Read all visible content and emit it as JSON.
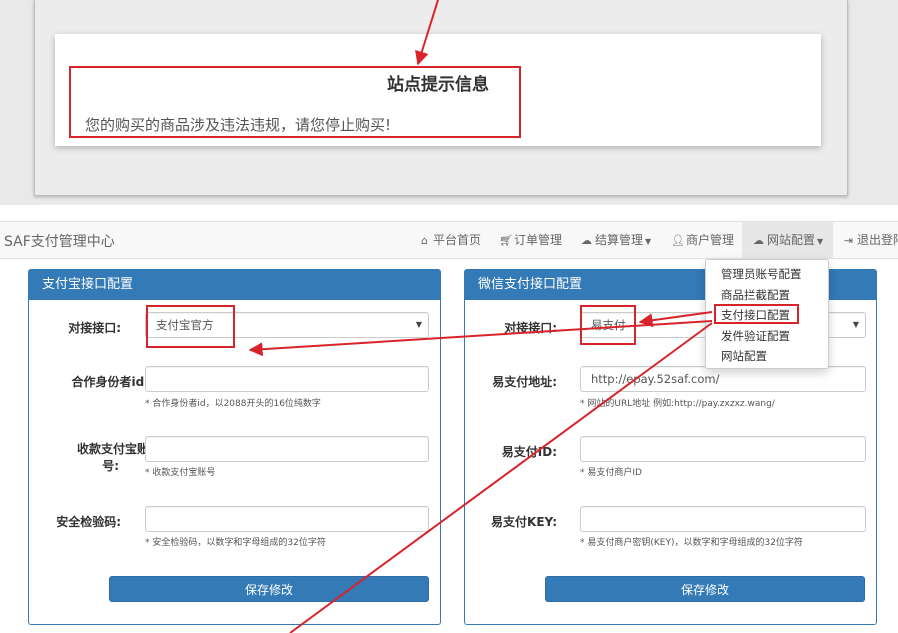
{
  "notice": {
    "title": "站点提示信息",
    "message": "您的购买的商品涉及违法违规，请您停止购买!"
  },
  "navbar": {
    "brand": "SAF支付管理中心",
    "items": [
      {
        "label": "平台首页",
        "icon": "home-icon"
      },
      {
        "label": "订单管理",
        "icon": "cart-icon"
      },
      {
        "label": "结算管理",
        "icon": "cloud-icon"
      },
      {
        "label": "商户管理",
        "icon": "user-icon"
      },
      {
        "label": "网站配置",
        "icon": "cloud-icon"
      },
      {
        "label": "退出登陆",
        "icon": "logout-icon"
      }
    ]
  },
  "dropdown": {
    "items": [
      "管理员账号配置",
      "商品拦截配置",
      "支付接口配置",
      "发件验证配置",
      "网站配置"
    ]
  },
  "alipay_panel": {
    "title": "支付宝接口配置",
    "interface_label": "对接接口:",
    "interface_value": "支付宝官方",
    "partner_label": "合作身份者id:",
    "partner_help": "* 合作身份者id，以2088开头的16位纯数字",
    "account_label_line1": "收款支付宝账",
    "account_label_line2": "号:",
    "account_help": "* 收款支付宝账号",
    "security_label": "安全检验码:",
    "security_help": "* 安全检验码，以数字和字母组成的32位字符",
    "save_label": "保存修改"
  },
  "wechat_panel": {
    "title": "微信支付接口配置",
    "interface_label": "对接接口:",
    "interface_value": "易支付",
    "url_label": "易支付地址:",
    "url_value": "http://epay.52saf.com/",
    "url_help": "* 网站的URL地址 例如:http://pay.zxzxz.wang/",
    "id_label": "易支付ID:",
    "id_help": "* 易支付商户ID",
    "key_label": "易支付KEY:",
    "key_help": "* 易支付商户密钥(KEY)，以数字和字母组成的32位字符",
    "save_label": "保存修改"
  },
  "colors": {
    "primary": "#337ab7",
    "annotation_red": "#d9232a"
  }
}
